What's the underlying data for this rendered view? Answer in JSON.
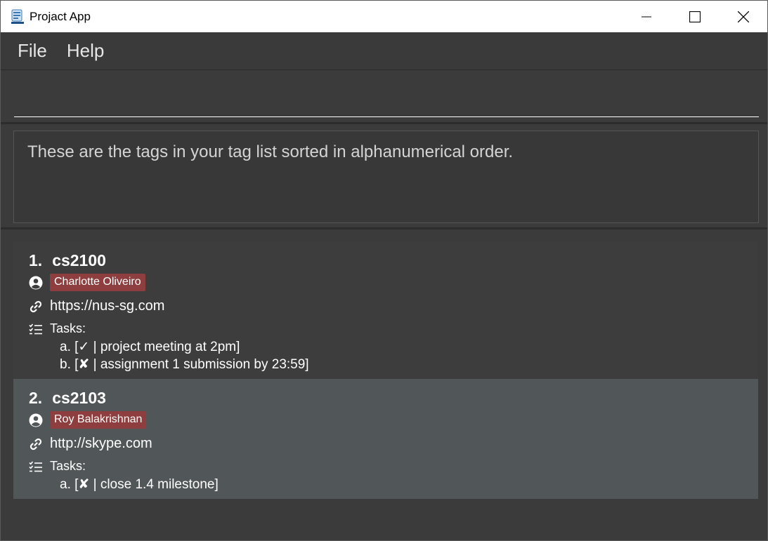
{
  "window": {
    "title": "Projact App"
  },
  "menu": {
    "items": [
      "File",
      "Help"
    ]
  },
  "command": {
    "value": "",
    "placeholder": ""
  },
  "result": {
    "text": "These are the tags in your tag list sorted in alphanumerical order."
  },
  "colors": {
    "tag_badge": "#8e3e3e",
    "card_odd": "#3d3d3d",
    "card_even": "#515658",
    "background": "#3b3b3b"
  },
  "tags": [
    {
      "index": "1.",
      "name": "cs2100",
      "member": "Charlotte Oliveiro",
      "meeting_link": "https://nus-sg.com",
      "tasks_label": "Tasks:",
      "tasks": [
        "a. [✓ | project meeting at 2pm]",
        "b. [✘ | assignment 1 submission by 23:59]"
      ]
    },
    {
      "index": "2.",
      "name": "cs2103",
      "member": "Roy Balakrishnan",
      "meeting_link": "http://skype.com",
      "tasks_label": "Tasks:",
      "tasks": [
        "a. [✘ | close 1.4 milestone]"
      ]
    }
  ],
  "icons": {
    "member": "user-circle-icon",
    "link": "link-icon",
    "tasks": "task-list-icon"
  }
}
